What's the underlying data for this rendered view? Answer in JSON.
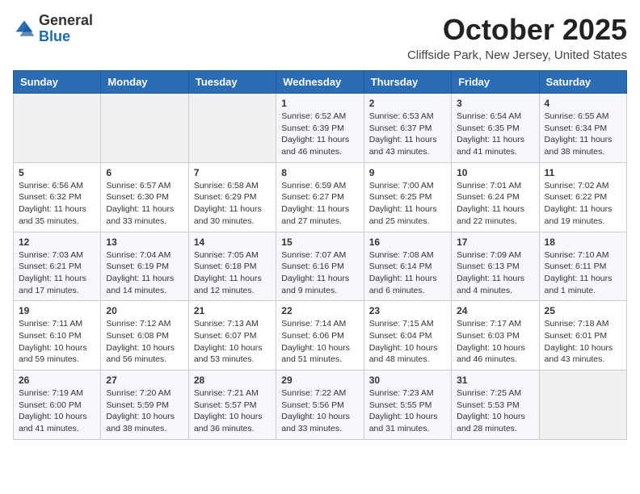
{
  "header": {
    "logo_general": "General",
    "logo_blue": "Blue",
    "month_title": "October 2025",
    "location": "Cliffside Park, New Jersey, United States"
  },
  "weekdays": [
    "Sunday",
    "Monday",
    "Tuesday",
    "Wednesday",
    "Thursday",
    "Friday",
    "Saturday"
  ],
  "weeks": [
    [
      {
        "day": "",
        "lines": []
      },
      {
        "day": "",
        "lines": []
      },
      {
        "day": "",
        "lines": []
      },
      {
        "day": "1",
        "lines": [
          "Sunrise: 6:52 AM",
          "Sunset: 6:39 PM",
          "Daylight: 11 hours",
          "and 46 minutes."
        ]
      },
      {
        "day": "2",
        "lines": [
          "Sunrise: 6:53 AM",
          "Sunset: 6:37 PM",
          "Daylight: 11 hours",
          "and 43 minutes."
        ]
      },
      {
        "day": "3",
        "lines": [
          "Sunrise: 6:54 AM",
          "Sunset: 6:35 PM",
          "Daylight: 11 hours",
          "and 41 minutes."
        ]
      },
      {
        "day": "4",
        "lines": [
          "Sunrise: 6:55 AM",
          "Sunset: 6:34 PM",
          "Daylight: 11 hours",
          "and 38 minutes."
        ]
      }
    ],
    [
      {
        "day": "5",
        "lines": [
          "Sunrise: 6:56 AM",
          "Sunset: 6:32 PM",
          "Daylight: 11 hours",
          "and 35 minutes."
        ]
      },
      {
        "day": "6",
        "lines": [
          "Sunrise: 6:57 AM",
          "Sunset: 6:30 PM",
          "Daylight: 11 hours",
          "and 33 minutes."
        ]
      },
      {
        "day": "7",
        "lines": [
          "Sunrise: 6:58 AM",
          "Sunset: 6:29 PM",
          "Daylight: 11 hours",
          "and 30 minutes."
        ]
      },
      {
        "day": "8",
        "lines": [
          "Sunrise: 6:59 AM",
          "Sunset: 6:27 PM",
          "Daylight: 11 hours",
          "and 27 minutes."
        ]
      },
      {
        "day": "9",
        "lines": [
          "Sunrise: 7:00 AM",
          "Sunset: 6:25 PM",
          "Daylight: 11 hours",
          "and 25 minutes."
        ]
      },
      {
        "day": "10",
        "lines": [
          "Sunrise: 7:01 AM",
          "Sunset: 6:24 PM",
          "Daylight: 11 hours",
          "and 22 minutes."
        ]
      },
      {
        "day": "11",
        "lines": [
          "Sunrise: 7:02 AM",
          "Sunset: 6:22 PM",
          "Daylight: 11 hours",
          "and 19 minutes."
        ]
      }
    ],
    [
      {
        "day": "12",
        "lines": [
          "Sunrise: 7:03 AM",
          "Sunset: 6:21 PM",
          "Daylight: 11 hours",
          "and 17 minutes."
        ]
      },
      {
        "day": "13",
        "lines": [
          "Sunrise: 7:04 AM",
          "Sunset: 6:19 PM",
          "Daylight: 11 hours",
          "and 14 minutes."
        ]
      },
      {
        "day": "14",
        "lines": [
          "Sunrise: 7:05 AM",
          "Sunset: 6:18 PM",
          "Daylight: 11 hours",
          "and 12 minutes."
        ]
      },
      {
        "day": "15",
        "lines": [
          "Sunrise: 7:07 AM",
          "Sunset: 6:16 PM",
          "Daylight: 11 hours",
          "and 9 minutes."
        ]
      },
      {
        "day": "16",
        "lines": [
          "Sunrise: 7:08 AM",
          "Sunset: 6:14 PM",
          "Daylight: 11 hours",
          "and 6 minutes."
        ]
      },
      {
        "day": "17",
        "lines": [
          "Sunrise: 7:09 AM",
          "Sunset: 6:13 PM",
          "Daylight: 11 hours",
          "and 4 minutes."
        ]
      },
      {
        "day": "18",
        "lines": [
          "Sunrise: 7:10 AM",
          "Sunset: 6:11 PM",
          "Daylight: 11 hours",
          "and 1 minute."
        ]
      }
    ],
    [
      {
        "day": "19",
        "lines": [
          "Sunrise: 7:11 AM",
          "Sunset: 6:10 PM",
          "Daylight: 10 hours",
          "and 59 minutes."
        ]
      },
      {
        "day": "20",
        "lines": [
          "Sunrise: 7:12 AM",
          "Sunset: 6:08 PM",
          "Daylight: 10 hours",
          "and 56 minutes."
        ]
      },
      {
        "day": "21",
        "lines": [
          "Sunrise: 7:13 AM",
          "Sunset: 6:07 PM",
          "Daylight: 10 hours",
          "and 53 minutes."
        ]
      },
      {
        "day": "22",
        "lines": [
          "Sunrise: 7:14 AM",
          "Sunset: 6:06 PM",
          "Daylight: 10 hours",
          "and 51 minutes."
        ]
      },
      {
        "day": "23",
        "lines": [
          "Sunrise: 7:15 AM",
          "Sunset: 6:04 PM",
          "Daylight: 10 hours",
          "and 48 minutes."
        ]
      },
      {
        "day": "24",
        "lines": [
          "Sunrise: 7:17 AM",
          "Sunset: 6:03 PM",
          "Daylight: 10 hours",
          "and 46 minutes."
        ]
      },
      {
        "day": "25",
        "lines": [
          "Sunrise: 7:18 AM",
          "Sunset: 6:01 PM",
          "Daylight: 10 hours",
          "and 43 minutes."
        ]
      }
    ],
    [
      {
        "day": "26",
        "lines": [
          "Sunrise: 7:19 AM",
          "Sunset: 6:00 PM",
          "Daylight: 10 hours",
          "and 41 minutes."
        ]
      },
      {
        "day": "27",
        "lines": [
          "Sunrise: 7:20 AM",
          "Sunset: 5:59 PM",
          "Daylight: 10 hours",
          "and 38 minutes."
        ]
      },
      {
        "day": "28",
        "lines": [
          "Sunrise: 7:21 AM",
          "Sunset: 5:57 PM",
          "Daylight: 10 hours",
          "and 36 minutes."
        ]
      },
      {
        "day": "29",
        "lines": [
          "Sunrise: 7:22 AM",
          "Sunset: 5:56 PM",
          "Daylight: 10 hours",
          "and 33 minutes."
        ]
      },
      {
        "day": "30",
        "lines": [
          "Sunrise: 7:23 AM",
          "Sunset: 5:55 PM",
          "Daylight: 10 hours",
          "and 31 minutes."
        ]
      },
      {
        "day": "31",
        "lines": [
          "Sunrise: 7:25 AM",
          "Sunset: 5:53 PM",
          "Daylight: 10 hours",
          "and 28 minutes."
        ]
      },
      {
        "day": "",
        "lines": []
      }
    ]
  ]
}
